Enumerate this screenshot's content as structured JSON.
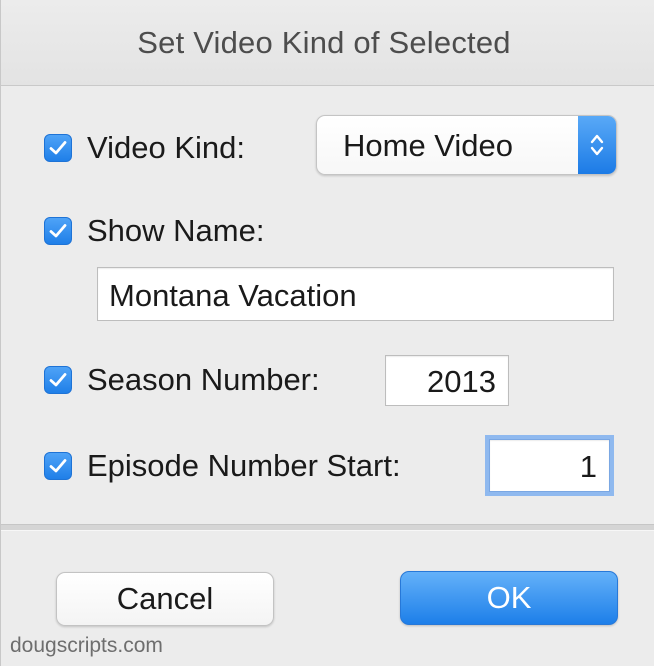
{
  "window": {
    "title": "Set Video Kind of Selected"
  },
  "fields": {
    "video_kind": {
      "label": "Video Kind:",
      "checked": true,
      "selected": "Home Video"
    },
    "show_name": {
      "label": "Show Name:",
      "checked": true,
      "value": "Montana Vacation"
    },
    "season_number": {
      "label": "Season Number:",
      "checked": true,
      "value": "2013"
    },
    "episode_number_start": {
      "label": "Episode Number Start:",
      "checked": true,
      "value": "1"
    }
  },
  "buttons": {
    "cancel_label": "Cancel",
    "ok_label": "OK"
  },
  "footer": {
    "credit": "dougscripts.com"
  },
  "colors": {
    "accent": "#1f7fe8",
    "focus_ring": "#8fb9ef",
    "background": "#ececec"
  },
  "icons": {
    "checkbox": "checkmark-icon",
    "popup": "chevron-up-down-icon"
  }
}
